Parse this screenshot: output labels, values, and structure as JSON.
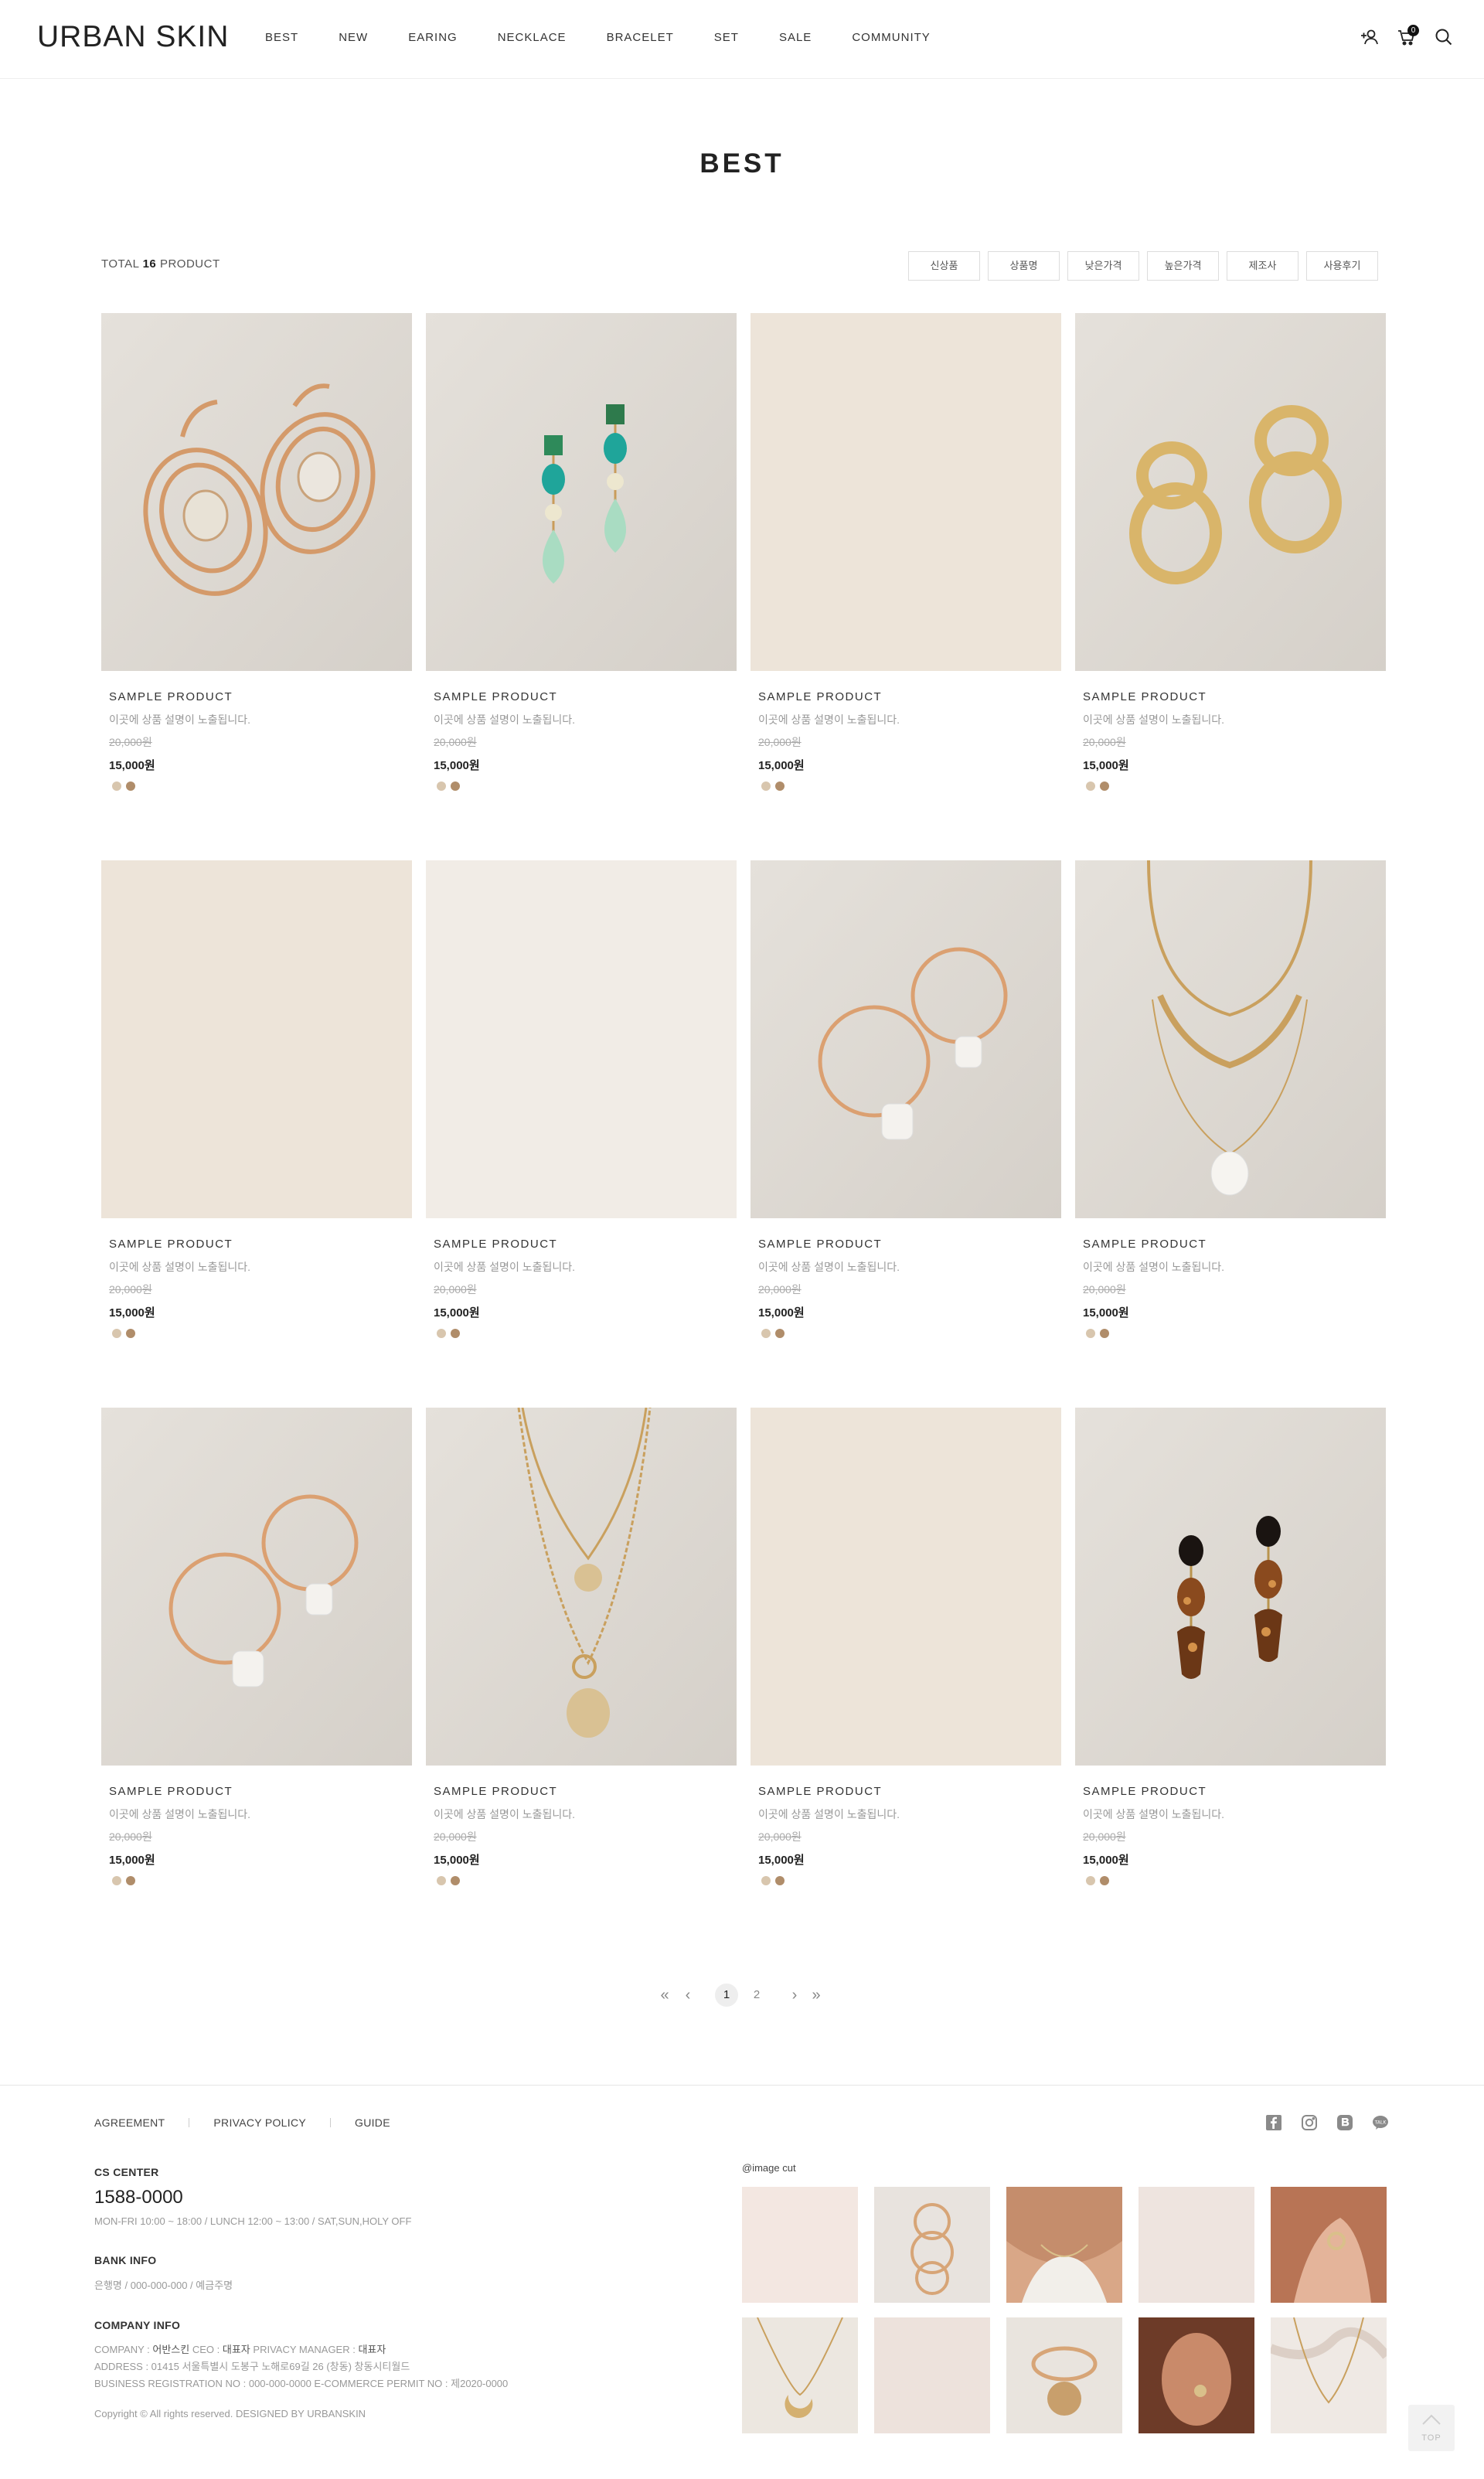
{
  "header": {
    "logo": "URBAN SKIN",
    "nav": [
      "BEST",
      "NEW",
      "EARING",
      "NECKLACE",
      "BRACELET",
      "SET",
      "SALE",
      "COMMUNITY"
    ],
    "cart_count": "0",
    "icons": [
      "add-user-icon",
      "cart-icon",
      "search-icon"
    ]
  },
  "page": {
    "title": "BEST",
    "total_prefix": "TOTAL",
    "total_count": "16",
    "total_suffix": "PRODUCT",
    "sort_options": [
      "신상품",
      "상품명",
      "낮은가격",
      "높은가격",
      "제조사",
      "사용후기"
    ]
  },
  "products": [
    {
      "name": "SAMPLE PRODUCT",
      "desc": "이곳에 상품 설명이 노출됩니다.",
      "old_price": "20,000원",
      "price": "15,000원",
      "image": "gold-swirl-earrings"
    },
    {
      "name": "SAMPLE PRODUCT",
      "desc": "이곳에 상품 설명이 노출됩니다.",
      "old_price": "20,000원",
      "price": "15,000원",
      "image": "green-drop-earrings"
    },
    {
      "name": "SAMPLE PRODUCT",
      "desc": "이곳에 상품 설명이 노출됩니다.",
      "old_price": "20,000원",
      "price": "15,000원",
      "image": "blank-beige"
    },
    {
      "name": "SAMPLE PRODUCT",
      "desc": "이곳에 상품 설명이 노출됩니다.",
      "old_price": "20,000원",
      "price": "15,000원",
      "image": "gold-ring-earrings"
    },
    {
      "name": "SAMPLE PRODUCT",
      "desc": "이곳에 상품 설명이 노출됩니다.",
      "old_price": "20,000원",
      "price": "15,000원",
      "image": "blank-beige"
    },
    {
      "name": "SAMPLE PRODUCT",
      "desc": "이곳에 상품 설명이 노출됩니다.",
      "old_price": "20,000원",
      "price": "15,000원",
      "image": "blank-light"
    },
    {
      "name": "SAMPLE PRODUCT",
      "desc": "이곳에 상품 설명이 노출됩니다.",
      "old_price": "20,000원",
      "price": "15,000원",
      "image": "pearl-hoop-earrings"
    },
    {
      "name": "SAMPLE PRODUCT",
      "desc": "이곳에 상품 설명이 노출됩니다.",
      "old_price": "20,000원",
      "price": "15,000원",
      "image": "pearl-layered-necklace"
    },
    {
      "name": "SAMPLE PRODUCT",
      "desc": "이곳에 상품 설명이 노출됩니다.",
      "old_price": "20,000원",
      "price": "15,000원",
      "image": "pearl-hoop-earrings"
    },
    {
      "name": "SAMPLE PRODUCT",
      "desc": "이곳에 상품 설명이 노출됩니다.",
      "old_price": "20,000원",
      "price": "15,000원",
      "image": "coin-layered-necklace"
    },
    {
      "name": "SAMPLE PRODUCT",
      "desc": "이곳에 상품 설명이 노출됩니다.",
      "old_price": "20,000원",
      "price": "15,000원",
      "image": "blank-beige"
    },
    {
      "name": "SAMPLE PRODUCT",
      "desc": "이곳에 상품 설명이 노출됩니다.",
      "old_price": "20,000원",
      "price": "15,000원",
      "image": "tortoise-earrings"
    }
  ],
  "swatch_colors": [
    "#d8c6ae",
    "#b08d6a"
  ],
  "pagination": {
    "first": "«",
    "prev": "‹",
    "pages": [
      "1",
      "2"
    ],
    "current": "1",
    "next": "›",
    "last": "»"
  },
  "footer": {
    "links": [
      "AGREEMENT",
      "PRIVACY POLICY",
      "GUIDE"
    ],
    "socials": [
      "facebook-icon",
      "instagram-icon",
      "blog-icon",
      "kakaotalk-icon"
    ],
    "cs_title": "CS CENTER",
    "cs_phone": "1588-0000",
    "cs_hours": "MON-FRI 10:00 ~ 18:00 / LUNCH 12:00 ~ 13:00 / SAT,SUN,HOLY OFF",
    "bank_title": "BANK INFO",
    "bank_text": "은행명 / 000-000-000 / 예금주명",
    "company_title": "COMPANY INFO",
    "company_line1_label1": "COMPANY :",
    "company_line1_value1": "어반스킨",
    "company_line1_label2": "CEO :",
    "company_line1_value2": "대표자",
    "company_line1_label3": "PRIVACY MANAGER :",
    "company_line1_value3": "대표자",
    "company_line2": "ADDRESS : 01415 서울특별시 도봉구 노해로69길 26 (창동) 창동시티월드",
    "company_line3": "BUSINESS REGISTRATION NO : 000-000-0000 E-COMMERCE PERMIT NO : 제2020-0000",
    "copyright": "Copyright © All rights reserved. DESIGNED BY URBANSKIN",
    "image_cut_title": "@image cut",
    "image_cuts": [
      "pink-blank",
      "gold-rings",
      "necklace-model",
      "beige-blank",
      "ring-hand",
      "moon-necklace",
      "rose-blank",
      "coin-bracelet",
      "earring-model",
      "marble-necklace"
    ],
    "top_label": "TOP"
  }
}
